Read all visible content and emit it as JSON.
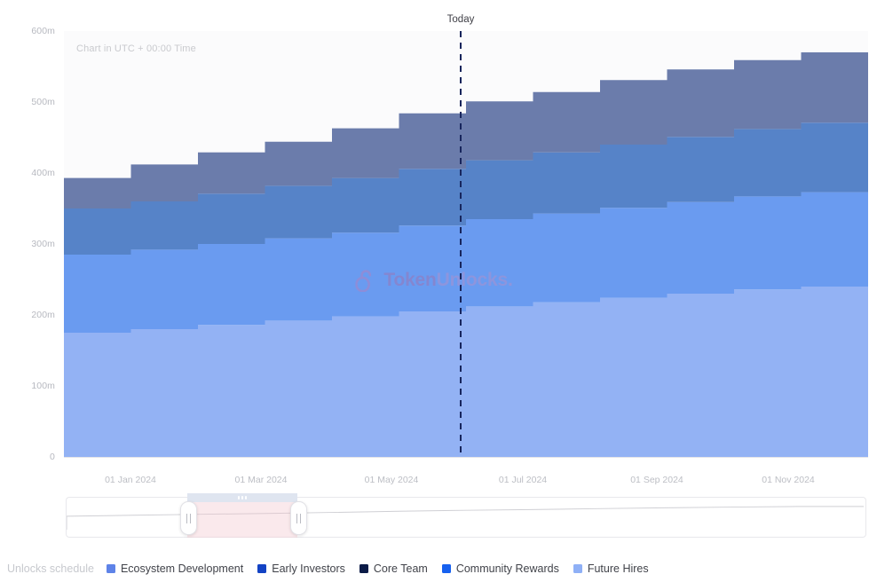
{
  "chart_data": {
    "type": "area",
    "title": "",
    "subtitle": "Chart in UTC + 00:00 Time",
    "stacked": true,
    "step": "monthly",
    "xlabel": "",
    "ylabel": "",
    "ylim": [
      0,
      600000000
    ],
    "y_ticks": [
      "0",
      "100m",
      "200m",
      "300m",
      "400m",
      "500m",
      "600m"
    ],
    "y_tick_values": [
      0,
      100000000,
      200000000,
      300000000,
      400000000,
      500000000,
      600000000
    ],
    "x_ticks": [
      "01 Jan 2024",
      "01 Mar 2024",
      "01 May 2024",
      "01 Jul 2024",
      "01 Sep 2024",
      "01 Nov 2024"
    ],
    "grid": true,
    "legend_position": "bottom",
    "annotations": [
      {
        "name": "today-marker",
        "label": "Today",
        "x": "01 Jun 2024",
        "style": "dashed-vertical"
      }
    ],
    "watermark": {
      "brand_bold": "Token",
      "brand_light": "Unlocks.",
      "icon": "open-padlock-icon"
    },
    "x": [
      "01 Dec 2023",
      "01 Jan 2024",
      "01 Feb 2024",
      "01 Mar 2024",
      "01 Apr 2024",
      "01 May 2024",
      "01 Jun 2024",
      "01 Jul 2024",
      "01 Aug 2024",
      "01 Sep 2024",
      "01 Oct 2024",
      "01 Nov 2024",
      "01 Dec 2024"
    ],
    "series": [
      {
        "name": "Future Hires",
        "color": "#93b2f4",
        "values": [
          175,
          180,
          186,
          192,
          198,
          205,
          212,
          218,
          224,
          230,
          236,
          240,
          240
        ]
      },
      {
        "name": "Community Rewards",
        "color": "#6a9bf0",
        "values": [
          110,
          112,
          114,
          116,
          118,
          121,
          123,
          125,
          127,
          129,
          131,
          133,
          133
        ]
      },
      {
        "name": "Ecosystem Development",
        "color": "#5683c8",
        "values": [
          65,
          68,
          71,
          74,
          77,
          80,
          83,
          86,
          89,
          92,
          95,
          98,
          98
        ]
      },
      {
        "name": "Early Investors",
        "color": "#6b7cab",
        "values": [
          43,
          52,
          58,
          62,
          70,
          78,
          83,
          85,
          91,
          95,
          97,
          99,
          99
        ]
      },
      {
        "name": "Core Team",
        "color": "#0b1b47",
        "values": [
          0,
          0,
          0,
          0,
          0,
          0,
          0,
          0,
          0,
          0,
          0,
          0,
          0
        ]
      }
    ],
    "totals": [
      393,
      412,
      429,
      444,
      463,
      484,
      501,
      514,
      531,
      546,
      559,
      570,
      570
    ]
  },
  "legend": {
    "title": "Unlocks schedule",
    "items": [
      {
        "label": "Ecosystem Development",
        "color": "#5e83e8"
      },
      {
        "label": "Early Investors",
        "color": "#1343c4"
      },
      {
        "label": "Core Team",
        "color": "#0b1b47"
      },
      {
        "label": "Community Rewards",
        "color": "#1761ef"
      },
      {
        "label": "Future Hires",
        "color": "#8fb0f6"
      }
    ]
  },
  "brush": {
    "name": "range-slider",
    "selection_start": "01 Jan 2024",
    "selection_end": "01 Mar 2024",
    "handle_left": "drag-handle-left",
    "handle_right": "drag-handle-right"
  }
}
